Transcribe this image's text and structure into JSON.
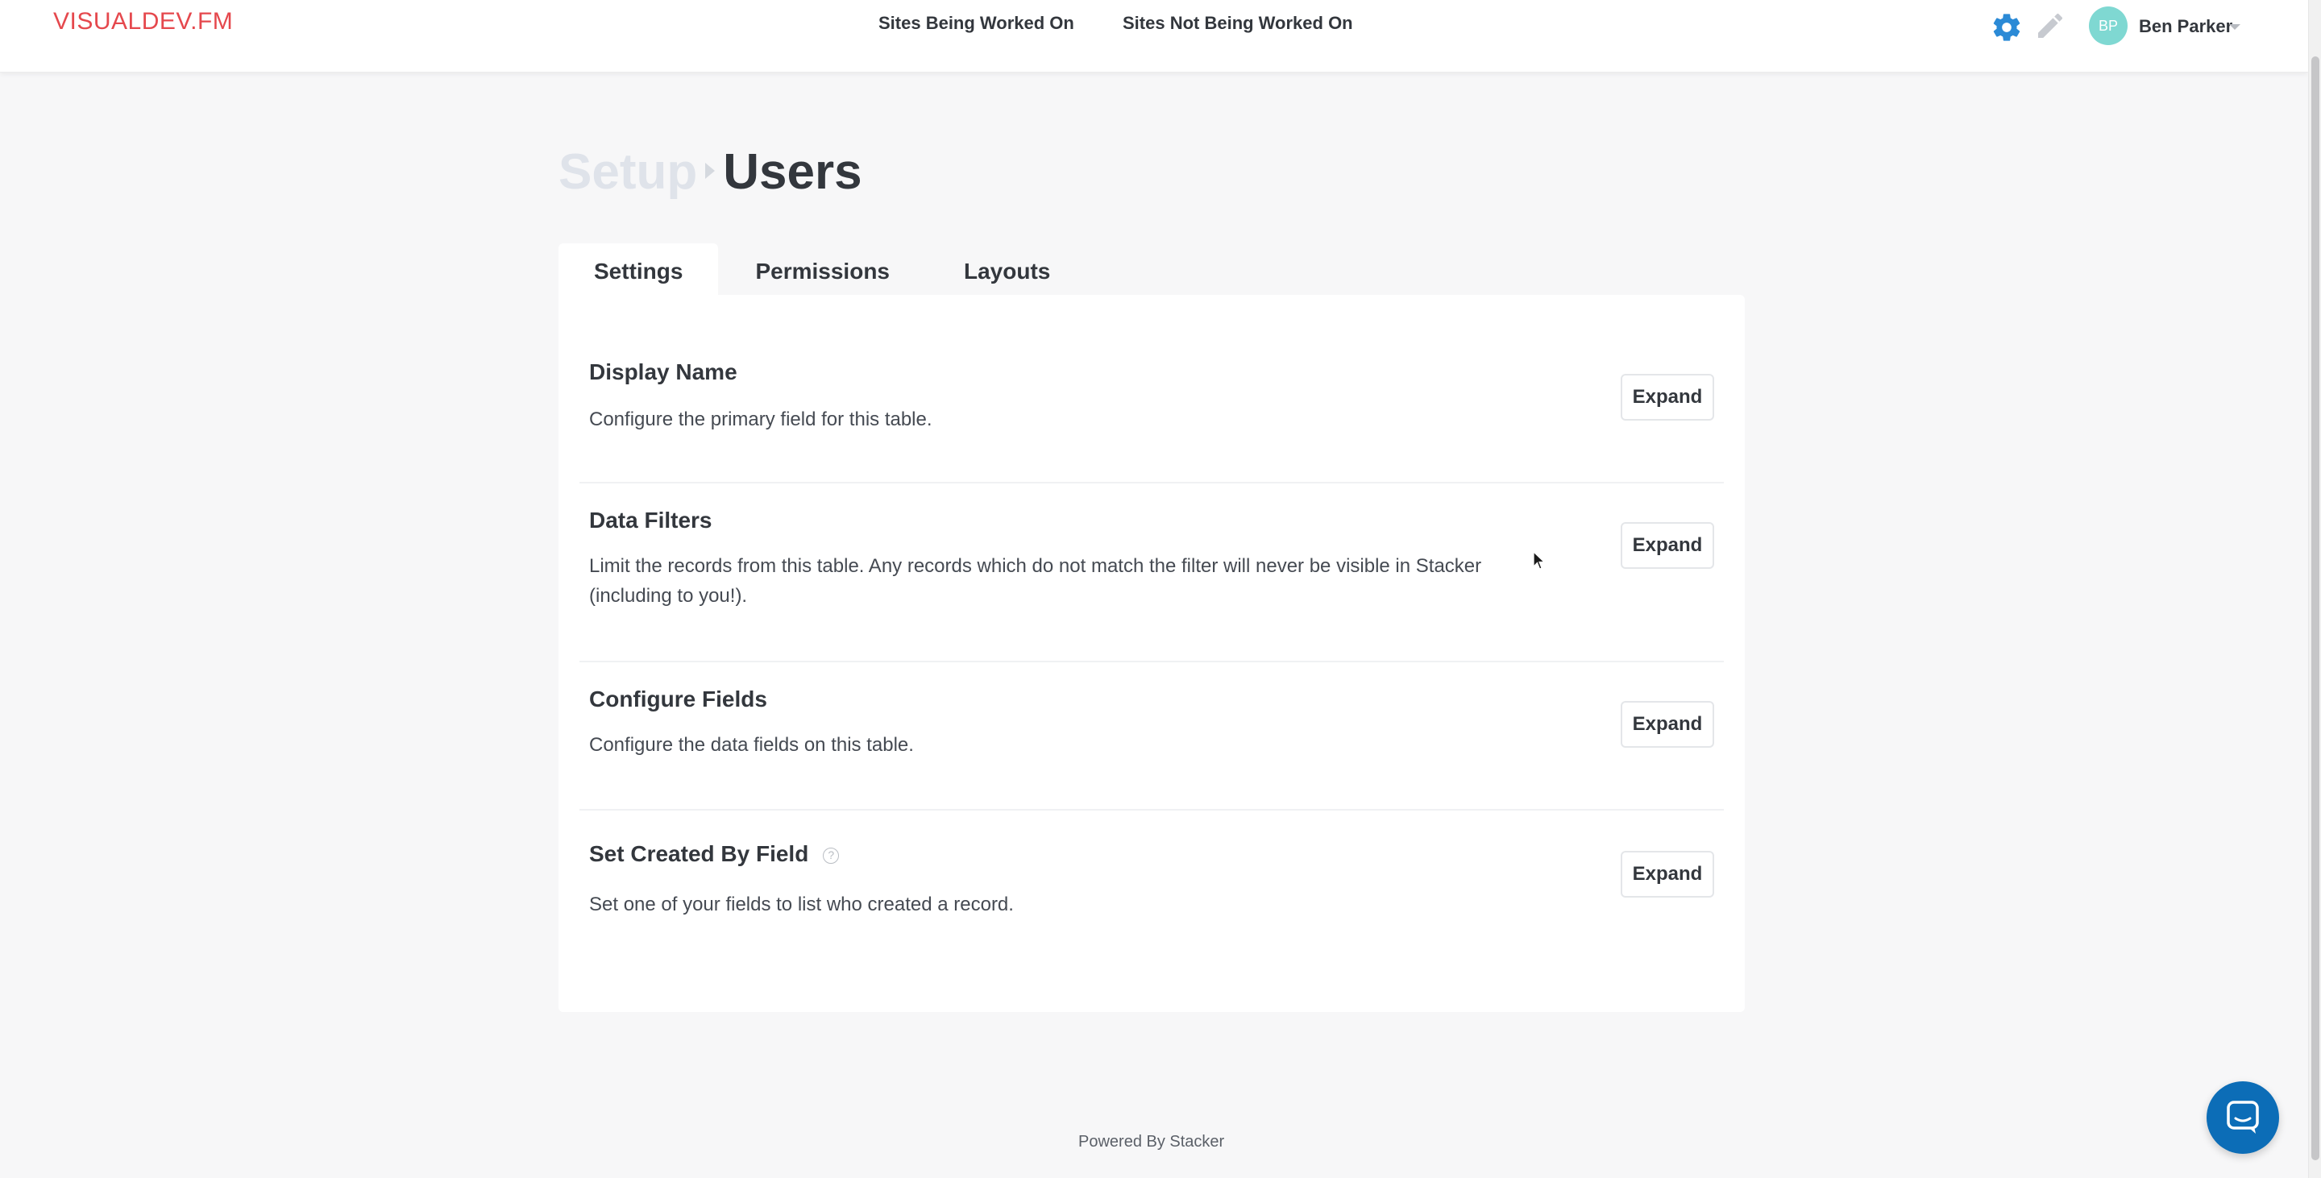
{
  "header": {
    "logo": "VISUALDEV.FM",
    "nav": [
      "Sites Being Worked On",
      "Sites Not Being Worked On"
    ],
    "user": {
      "initials": "BP",
      "name": "Ben Parker"
    },
    "icons": [
      "gear-icon",
      "pencil-icon",
      "chevron-down-icon"
    ],
    "accent_color": "#2b8ad6"
  },
  "page": {
    "breadcrumb_parent": "Setup",
    "title": "Users"
  },
  "tabs": [
    {
      "label": "Settings",
      "active": true
    },
    {
      "label": "Permissions",
      "active": false
    },
    {
      "label": "Layouts",
      "active": false
    }
  ],
  "sections": [
    {
      "title": "Display Name",
      "description": "Configure the primary field for this table.",
      "button": "Expand"
    },
    {
      "title": "Data Filters",
      "description": "Limit the records from this table. Any records which do not match the filter will never be visible in Stacker (including to you!).",
      "button": "Expand"
    },
    {
      "title": "Configure Fields",
      "description": "Configure the data fields on this table.",
      "button": "Expand"
    },
    {
      "title": "Set Created By Field",
      "help_icon": "question-circle-icon",
      "help_glyph": "?",
      "description": "Set one of your fields to list who created a record.",
      "button": "Expand"
    }
  ],
  "footer": {
    "text": "Powered By Stacker"
  },
  "chat": {
    "icon": "chat-bubble-icon",
    "color": "#0c6db7"
  }
}
